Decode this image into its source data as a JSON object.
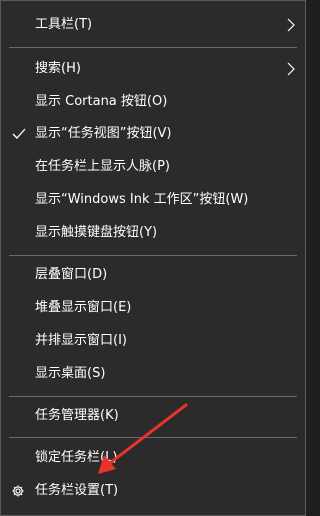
{
  "menu": {
    "toolbars": {
      "label": "工具栏(T)"
    },
    "search": {
      "label": "搜索(H)"
    },
    "cortana": {
      "label": "显示 Cortana 按钮(O)"
    },
    "task_view": {
      "label": "显示“任务视图”按钮(V)",
      "checked": true
    },
    "people": {
      "label": "在任务栏上显示人脉(P)"
    },
    "ink": {
      "label": "显示“Windows Ink 工作区”按钮(W)"
    },
    "touch_keyboard": {
      "label": "显示触摸键盘按钮(Y)"
    },
    "cascade": {
      "label": "层叠窗口(D)"
    },
    "stacked": {
      "label": "堆叠显示窗口(E)"
    },
    "side_by_side": {
      "label": "并排显示窗口(I)"
    },
    "desktop": {
      "label": "显示桌面(S)"
    },
    "task_manager": {
      "label": "任务管理器(K)"
    },
    "lock": {
      "label": "锁定任务栏(L)"
    },
    "settings": {
      "label": "任务栏设置(T)",
      "icon": "gear-icon"
    }
  },
  "colors": {
    "menu_bg": "#2b2b2b",
    "text": "#ffffff",
    "separator": "#6b6b6b",
    "annotation_arrow": "#e8322b"
  }
}
